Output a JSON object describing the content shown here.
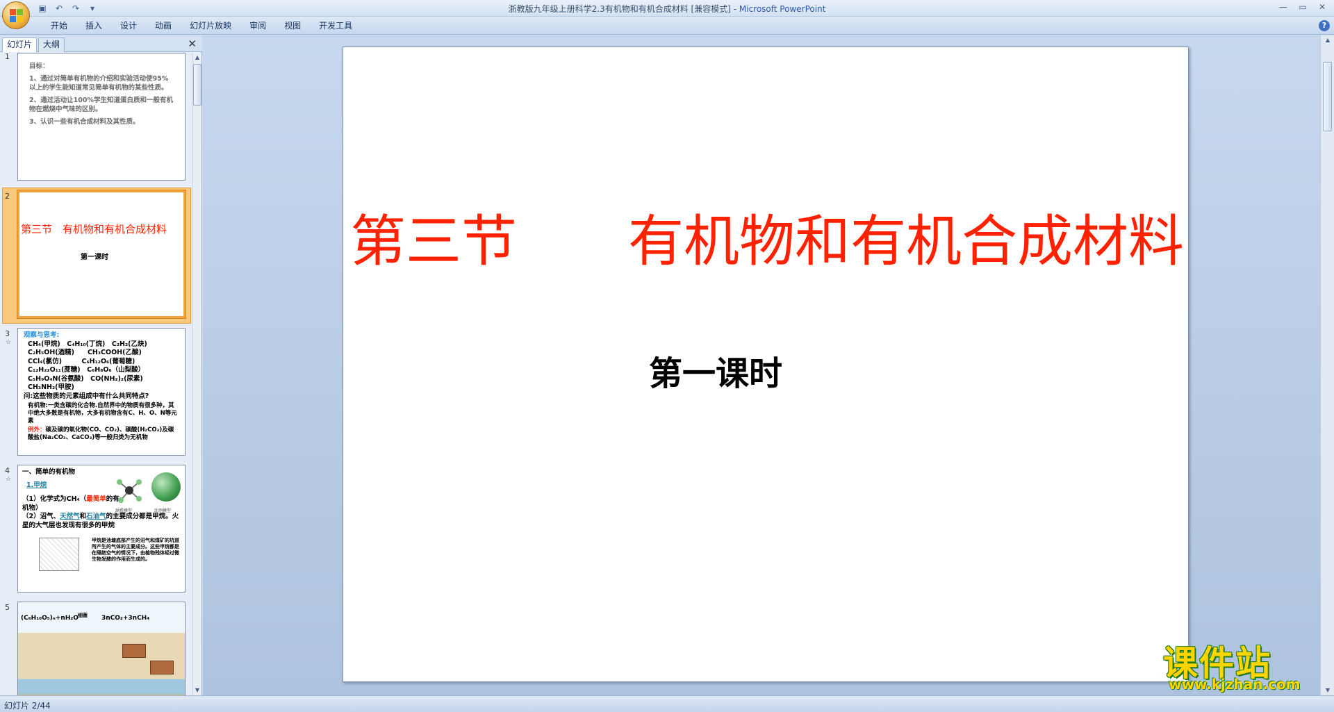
{
  "window": {
    "title": "浙教版九年级上册科学2.3有机物和有机合成材料 [兼容模式] - ",
    "app_name": "Microsoft PowerPoint",
    "controls": [
      "—",
      "▭",
      "✕"
    ]
  },
  "quick_access": [
    "save-icon",
    "undo-icon",
    "redo-icon",
    "customize-icon"
  ],
  "ribbon": {
    "tabs": [
      "开始",
      "插入",
      "设计",
      "动画",
      "幻灯片放映",
      "审阅",
      "视图",
      "开发工具"
    ],
    "help": "?"
  },
  "left_panel": {
    "tabs": [
      "幻灯片",
      "大纲"
    ],
    "close": "✕",
    "slides": [
      {
        "number": "1",
        "lines": [
          "目标：",
          "1、通过对简单有机物的介绍和实验活动使95%以上的学生能知道常见简单有机物的某些性质。",
          "2、通过活动让100%学生知道蛋白质和一般有机物在燃烧中气味的区别。",
          "3、认识一些有机合成材料及其性质。"
        ]
      },
      {
        "number": "2",
        "title": "第三节　有机物和有机合成材料",
        "subtitle": "第一课时"
      },
      {
        "number": "3",
        "star": "☆",
        "heading": "观察与思考:",
        "formulas": [
          "CH₄(甲烷)　C₄H₁₀(丁烷)　C₂H₂(乙炔)",
          "C₂H₅OH(酒精)　　CH₃COOH(乙酸)",
          "CCl₄(氯仿)　　　C₆H₁₂O₆(葡萄糖)",
          "C₁₂H₂₂O₁₁(蔗糖)　C₆H₈O₆（山梨酸）",
          "C₅H₉O₄N(谷氨酸)　CO(NH₂)₂(尿素)",
          "CH₃NH₂(甲胺)"
        ],
        "question": "问:这些物质的元素组成中有什么共同特点?",
        "definition": "有机物:一类含碳的化合物.自然界中的物质有很多种，其中绝大多数是有机物，大多有机物含有C、H、O、N等元素",
        "exception_label": "例外：",
        "exception": "碳及碳的氧化物(CO、CO₂)、碳酸(H₂CO₃)及碳酸盐(Na₂CO₃、CaCO₃)等一般归类为无机物"
      },
      {
        "number": "4",
        "star": "☆",
        "heading": "一、简单的有机物",
        "item": "1.甲烷",
        "line1a": "（1）化学式为CH₄（",
        "line1b": "最简单",
        "line1c": "的有机物）",
        "line2a": "（2）沼气、",
        "line2b": "天然气",
        "line2c": "和",
        "line2d": "石油气",
        "line2e": "的主要成分都是甲烷。火星的大气层也发现有很多的甲烷",
        "caption_a": "球棍模型",
        "caption_b": "比例模型",
        "note": "甲烷是池塘底部产生的沼气和煤矿的坑道所产生的气体的主要成分。这些甲烷都是在隔绝空气的情况下，由植物残体经过微生物发酵的作用而生成的。"
      },
      {
        "number": "5",
        "equation_a": "(C₆H₁₀O₅)ₙ+nH₂O",
        "equation_mid": "细菌",
        "equation_b": "3nCO₂+3nCH₄"
      }
    ]
  },
  "slide": {
    "title": "第三节　　有机物和有机合成材料",
    "subtitle": "第一课时"
  },
  "status": {
    "text": "幻灯片 2/44"
  },
  "watermark": {
    "text": "课件站",
    "url": "www.kjzhan.com"
  },
  "colors": {
    "title_red": "#ff2200",
    "selection_orange": "#f0a23b",
    "watermark_yellow": "#ffd400"
  }
}
